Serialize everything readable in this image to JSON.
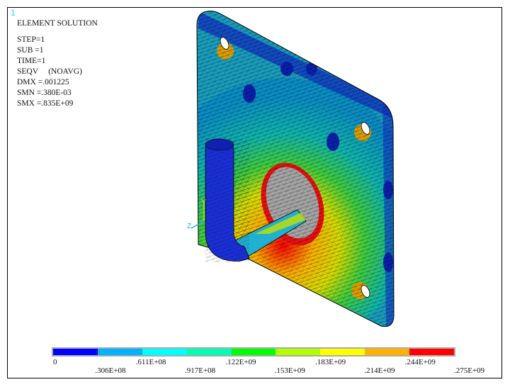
{
  "window_number": "1",
  "info": {
    "title": "ELEMENT SOLUTION",
    "lines": [
      "STEP=1",
      "SUB =1",
      "TIME=1",
      "SEQV     (NOAVG)",
      "DMX =.001225",
      "SMN =.380E-03",
      "SMX =.835E+09"
    ]
  },
  "triad": {
    "y_label": "Y",
    "z_label": "Z"
  },
  "legend": {
    "colors": [
      "#0000ff",
      "#00b2ff",
      "#00ffff",
      "#00ffb2",
      "#00ff00",
      "#b2ff00",
      "#ffff00",
      "#ffb200",
      "#ff0000"
    ],
    "labels_top": [
      "0",
      ".611E+08",
      ".122E+09",
      ".183E+09",
      ".244E+09"
    ],
    "labels_bottom": [
      ".306E+08",
      ".917E+08",
      ".153E+09",
      ".214E+09",
      ".275E+09"
    ]
  },
  "model": {
    "exceeds_max_color": "#a8a8a8"
  }
}
